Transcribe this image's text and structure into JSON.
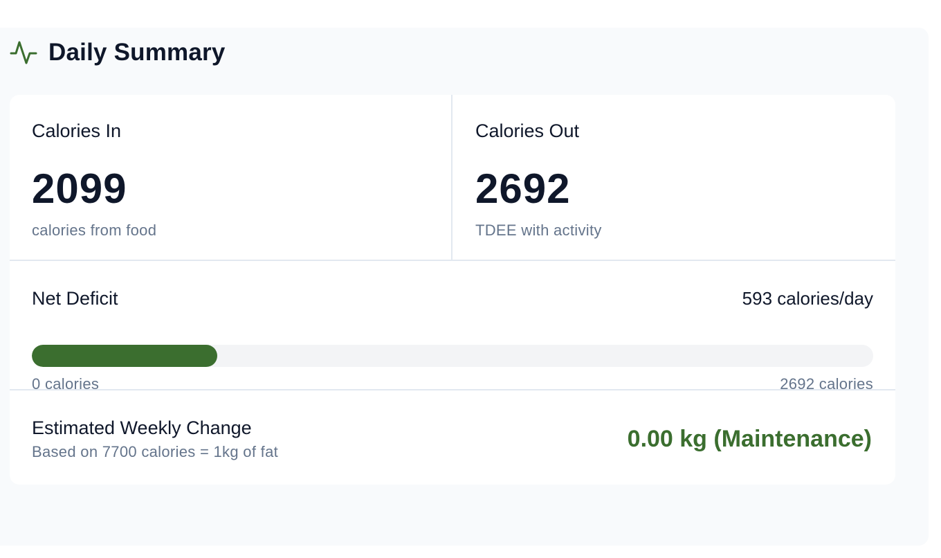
{
  "header": {
    "title": "Daily Summary",
    "icon": "activity-pulse-icon",
    "icon_color": "#3b6e2f"
  },
  "calories_in": {
    "label": "Calories In",
    "value": "2099",
    "sub": "calories from food"
  },
  "calories_out": {
    "label": "Calories Out",
    "value": "2692",
    "sub": "TDEE with activity"
  },
  "net_deficit": {
    "label": "Net Deficit",
    "rate": "593 calories/day",
    "progress_fraction": 0.22,
    "scale_min_label": "0 calories",
    "scale_max_label": "2692 calories",
    "bar_color": "#3b6e2f"
  },
  "weekly_change": {
    "label": "Estimated Weekly Change",
    "sub": "Based on 7700 calories = 1kg of fat",
    "value": "0.00 kg (Maintenance)",
    "value_color": "#3b6e2f"
  }
}
